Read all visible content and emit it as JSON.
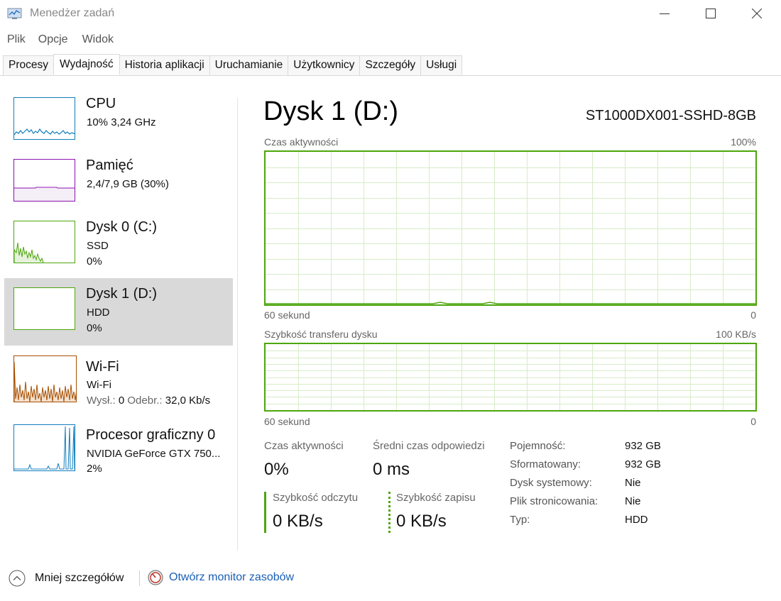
{
  "window": {
    "title": "Menedżer zadań"
  },
  "menu": [
    "Plik",
    "Opcje",
    "Widok"
  ],
  "tabs": [
    "Procesy",
    "Wydajność",
    "Historia aplikacji",
    "Uruchamianie",
    "Użytkownicy",
    "Szczegóły",
    "Usługi"
  ],
  "active_tab": "Wydajność",
  "sidebar": {
    "items": [
      {
        "title": "CPU",
        "line1": "10%  3,24 GHz",
        "line2": "",
        "color": "#117dbb"
      },
      {
        "title": "Pamięć",
        "line1": "2,4/7,9 GB (30%)",
        "line2": "",
        "color": "#8b12ae"
      },
      {
        "title": "Dysk 0 (C:)",
        "line1": "SSD",
        "line2": "0%",
        "color": "#4da60c"
      },
      {
        "title": "Dysk 1 (D:)",
        "line1": "HDD",
        "line2": "0%",
        "color": "#4da60c"
      },
      {
        "title": "Wi-Fi",
        "line1": "Wi-Fi",
        "line2_send_label": "Wysł.:",
        "line2_send_value": "0",
        "line2_recv_label": "Odebr.:",
        "line2_recv_value": "32,0 Kb/s",
        "color": "#a74f01"
      },
      {
        "title": "Procesor graficzny 0",
        "line1": "NVIDIA GeForce GTX 750...",
        "line2": "2%",
        "color": "#117dbb"
      }
    ],
    "selected_index": 3
  },
  "detail": {
    "title": "Dysk 1 (D:)",
    "model": "ST1000DX001-SSHD-8GB",
    "graph1": {
      "label": "Czas aktywności",
      "max_label": "100%",
      "time_label": "60 sekund",
      "min_label": "0"
    },
    "graph2": {
      "label": "Szybkość transferu dysku",
      "max_label": "100 KB/s",
      "time_label": "60 sekund",
      "min_label": "0"
    },
    "stats": {
      "active_time_label": "Czas aktywności",
      "active_time_value": "0%",
      "avg_response_label": "Średni czas odpowiedzi",
      "avg_response_value": "0 ms",
      "read_label": "Szybkość odczytu",
      "read_value": "0 KB/s",
      "write_label": "Szybkość zapisu",
      "write_value": "0 KB/s"
    },
    "properties": [
      {
        "label": "Pojemność:",
        "value": "932 GB"
      },
      {
        "label": "Sformatowany:",
        "value": "932 GB"
      },
      {
        "label": "Dysk systemowy:",
        "value": "Nie"
      },
      {
        "label": "Plik stronicowania:",
        "value": "Nie"
      },
      {
        "label": "Typ:",
        "value": "HDD"
      }
    ]
  },
  "footer": {
    "fewer_details": "Mniej szczegółów",
    "resource_monitor": "Otwórz monitor zasobów"
  },
  "colors": {
    "disk_green": "#4da60c",
    "cpu_blue": "#117dbb",
    "memory_purple": "#8b12ae",
    "wifi_orange": "#a74f01",
    "link_blue": "#1a5fb4",
    "selected_bg": "#d9d9d9"
  },
  "icons": {
    "app": "task-manager-icon",
    "minimize": "minimize-icon",
    "maximize": "maximize-icon",
    "close": "close-icon",
    "fewer_details": "chevron-up-circle-icon",
    "resource_monitor": "resource-monitor-icon"
  }
}
